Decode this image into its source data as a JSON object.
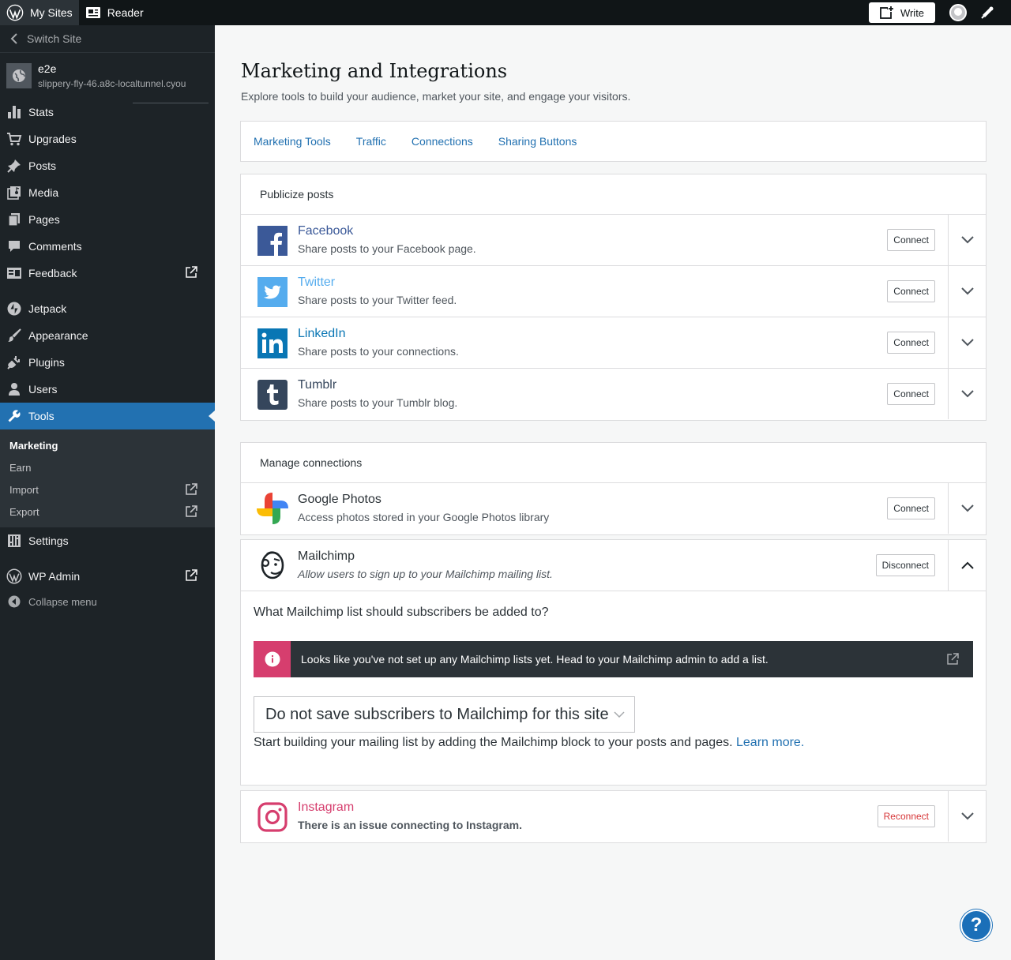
{
  "masterbar": {
    "my_sites": "My Sites",
    "reader": "Reader",
    "write": "Write"
  },
  "sidebar": {
    "switch_site": "Switch Site",
    "site_name": "e2e",
    "site_url": "slippery-fly-46.a8c-localtunnel.cyou",
    "items": [
      {
        "label": "Stats",
        "icon": "stats-icon"
      },
      {
        "label": "Upgrades",
        "icon": "cart-icon"
      },
      {
        "label": "Posts",
        "icon": "pin-icon"
      },
      {
        "label": "Media",
        "icon": "media-icon"
      },
      {
        "label": "Pages",
        "icon": "pages-icon"
      },
      {
        "label": "Comments",
        "icon": "comment-icon"
      },
      {
        "label": "Feedback",
        "icon": "feedback-icon"
      },
      {
        "label": "Jetpack",
        "icon": "jetpack-icon"
      },
      {
        "label": "Appearance",
        "icon": "brush-icon"
      },
      {
        "label": "Plugins",
        "icon": "plug-icon"
      },
      {
        "label": "Users",
        "icon": "user-icon"
      },
      {
        "label": "Tools",
        "icon": "wrench-icon"
      }
    ],
    "submenu": [
      "Marketing",
      "Earn",
      "Import",
      "Export"
    ],
    "settings": "Settings",
    "wp_admin": "WP Admin",
    "collapse": "Collapse menu"
  },
  "main": {
    "title": "Marketing and Integrations",
    "subtitle": "Explore tools to build your audience, market your site, and engage your visitors.",
    "tabs": [
      "Marketing Tools",
      "Traffic",
      "Connections",
      "Sharing Buttons"
    ]
  },
  "publicize": {
    "header": "Publicize posts",
    "services": [
      {
        "name": "Facebook",
        "desc": "Share posts to your Facebook page.",
        "button": "Connect",
        "color": "#3b5998"
      },
      {
        "name": "Twitter",
        "desc": "Share posts to your Twitter feed.",
        "button": "Connect",
        "color": "#55acee"
      },
      {
        "name": "LinkedIn",
        "desc": "Share posts to your connections.",
        "button": "Connect",
        "color": "#0976b4"
      },
      {
        "name": "Tumblr",
        "desc": "Share posts to your Tumblr blog.",
        "button": "Connect",
        "color": "#35465c"
      }
    ]
  },
  "manage": {
    "header": "Manage connections",
    "google_photos": {
      "name": "Google Photos",
      "desc": "Access photos stored in your Google Photos library",
      "button": "Connect"
    },
    "mailchimp": {
      "name": "Mailchimp",
      "desc": "Allow users to sign up to your Mailchimp mailing list.",
      "button": "Disconnect",
      "question": "What Mailchimp list should subscribers be added to?",
      "notice": "Looks like you've not set up any Mailchimp lists yet. Head to your Mailchimp admin to add a list.",
      "select_value": "Do not save subscribers to Mailchimp for this site",
      "help_text": "Start building your mailing list by adding the Mailchimp block to your posts and pages.",
      "learn_more": "Learn more."
    },
    "instagram": {
      "name": "Instagram",
      "desc": "There is an issue connecting to Instagram.",
      "button": "Reconnect",
      "color": "#d63e6e"
    }
  },
  "help": "?"
}
